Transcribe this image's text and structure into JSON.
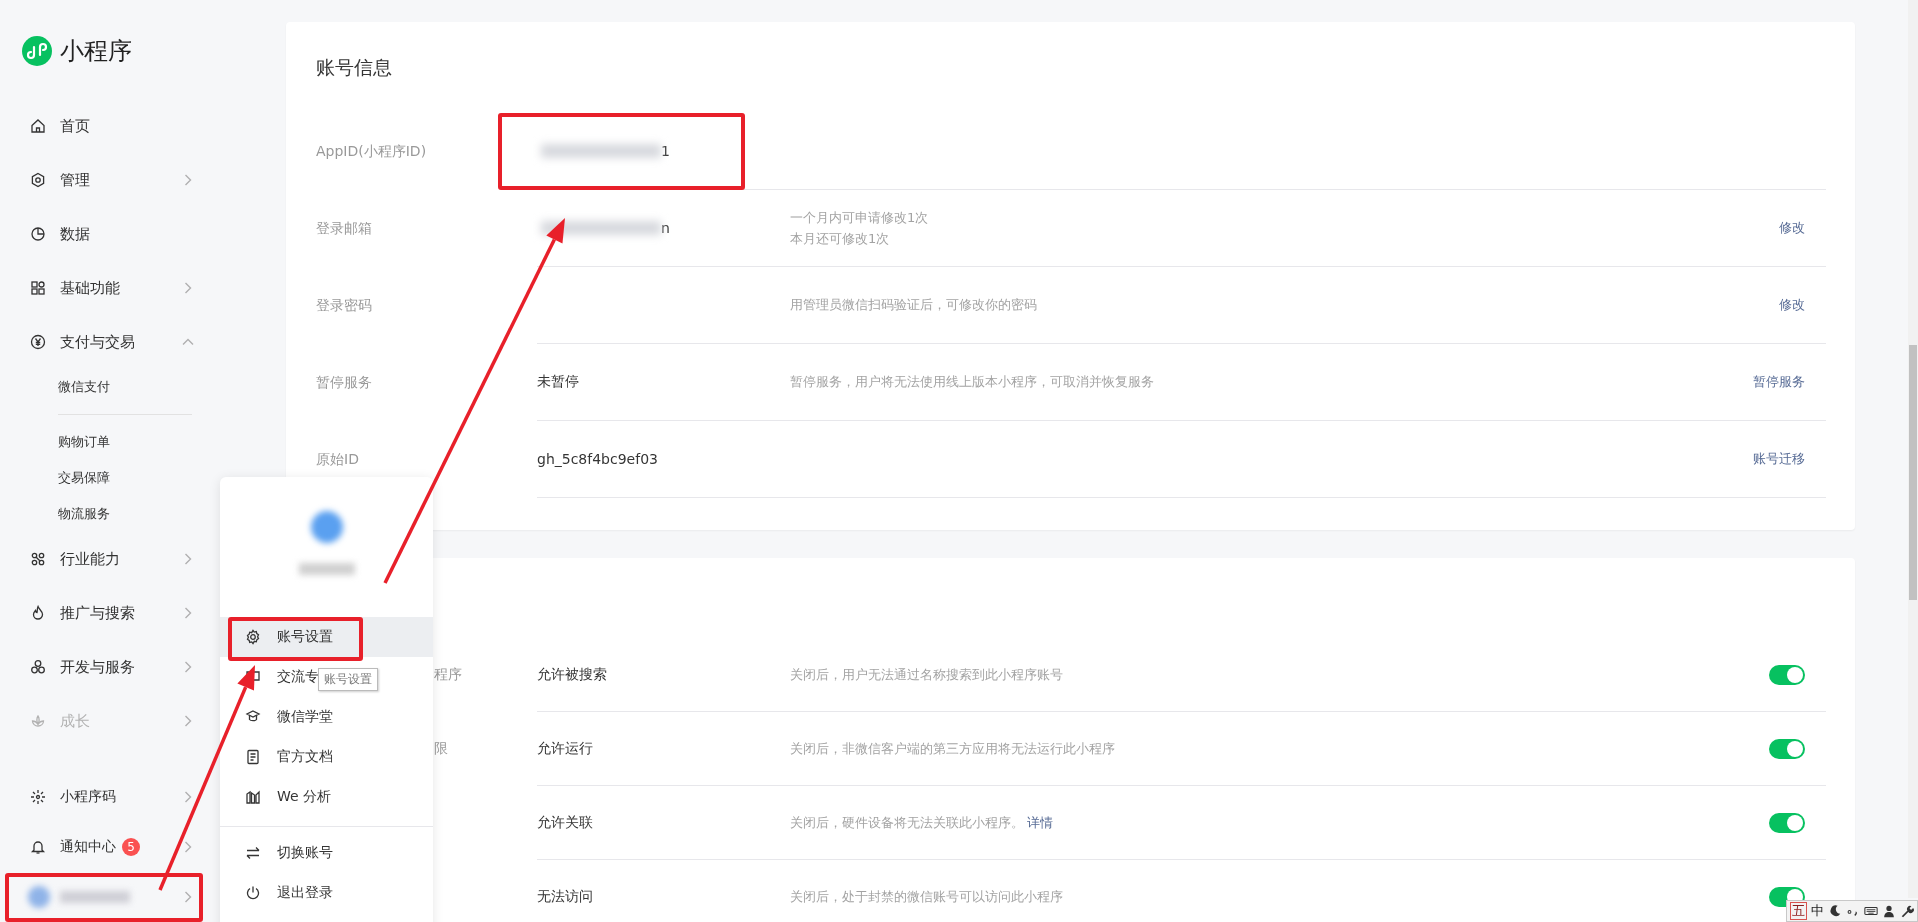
{
  "sidebar": {
    "logo": {
      "title": "小程序"
    },
    "nav": [
      {
        "label": "首页",
        "has_arrow": false,
        "disabled": false
      },
      {
        "label": "管理",
        "has_arrow": true,
        "expanded": false,
        "disabled": false
      },
      {
        "label": "数据",
        "has_arrow": false,
        "disabled": false
      },
      {
        "label": "基础功能",
        "has_arrow": true,
        "expanded": false,
        "disabled": false
      },
      {
        "label": "支付与交易",
        "has_arrow": true,
        "expanded": true,
        "disabled": false,
        "children": [
          {
            "kind": "link",
            "label": "微信支付"
          },
          {
            "kind": "divider"
          },
          {
            "kind": "link",
            "label": "购物订单"
          },
          {
            "kind": "link",
            "label": "交易保障"
          },
          {
            "kind": "link",
            "label": "物流服务"
          }
        ]
      },
      {
        "label": "行业能力",
        "has_arrow": true,
        "expanded": false,
        "disabled": false
      },
      {
        "label": "推广与搜索",
        "has_arrow": true,
        "expanded": false,
        "disabled": false
      },
      {
        "label": "开发与服务",
        "has_arrow": true,
        "expanded": false,
        "disabled": false
      },
      {
        "label": "成长",
        "has_arrow": true,
        "expanded": false,
        "disabled": true
      }
    ],
    "bottom": [
      {
        "kind": "link",
        "label": "小程序码"
      },
      {
        "kind": "link",
        "label": "通知中心",
        "badge": "5"
      },
      {
        "kind": "account"
      }
    ]
  },
  "account_card": {
    "title": "账号信息",
    "rows": [
      {
        "label": "AppID(小程序ID)",
        "value": "1",
        "masked": true
      },
      {
        "label": "登录邮箱",
        "value": "n",
        "masked": true,
        "notes": [
          "一个月内可申请修改1次",
          "本月还可修改1次"
        ],
        "action": "修改"
      },
      {
        "label": "登录密码",
        "masked": false,
        "notes": [
          "用管理员微信扫码验证后，可修改你的密码"
        ],
        "action": "修改"
      },
      {
        "label": "暂停服务",
        "value": "未暂停",
        "masked": false,
        "notes": [
          "暂停服务，用户将无法使用线上版本小程序，可取消并恢复服务"
        ],
        "action": "暂停服务"
      },
      {
        "label": "原始ID",
        "value": "gh_5c8f4bc9ef03",
        "masked": false,
        "action": "账号迁移"
      }
    ]
  },
  "settings_card": {
    "rows": [
      {
        "label": "程序",
        "value": "允许被搜索",
        "note": "关闭后，用户无法通过名称搜索到此小程序账号",
        "on": true
      },
      {
        "label": "限",
        "value": "允许运行",
        "note": "关闭后，非微信客户端的第三方应用将无法运行此小程序",
        "on": true
      },
      {
        "value": "允许关联",
        "note": "关闭后，硬件设备将无法关联此小程序。",
        "link": "详情",
        "on": true
      },
      {
        "value": "无法访问",
        "note": "关闭后，处于封禁的微信账号可以访问此小程序",
        "on": true
      }
    ]
  },
  "account_menu": {
    "sections": [
      {
        "items": [
          {
            "label": "账号设置",
            "selected": true
          },
          {
            "label": "交流专",
            "selected": false
          },
          {
            "label": "微信学堂",
            "selected": false
          },
          {
            "label": "官方文档",
            "selected": false
          },
          {
            "label": "We 分析",
            "selected": false
          }
        ]
      },
      {
        "items": [
          {
            "label": "切换账号",
            "selected": false
          },
          {
            "label": "退出登录",
            "selected": false
          }
        ]
      }
    ]
  },
  "tooltip": "账号设置",
  "annotations": [
    {
      "kind": "box"
    },
    {
      "kind": "box"
    },
    {
      "kind": "box"
    },
    {
      "kind": "arrow"
    },
    {
      "kind": "arrow"
    }
  ],
  "ime_toolbar": {
    "labels": [
      "五",
      "中"
    ]
  }
}
